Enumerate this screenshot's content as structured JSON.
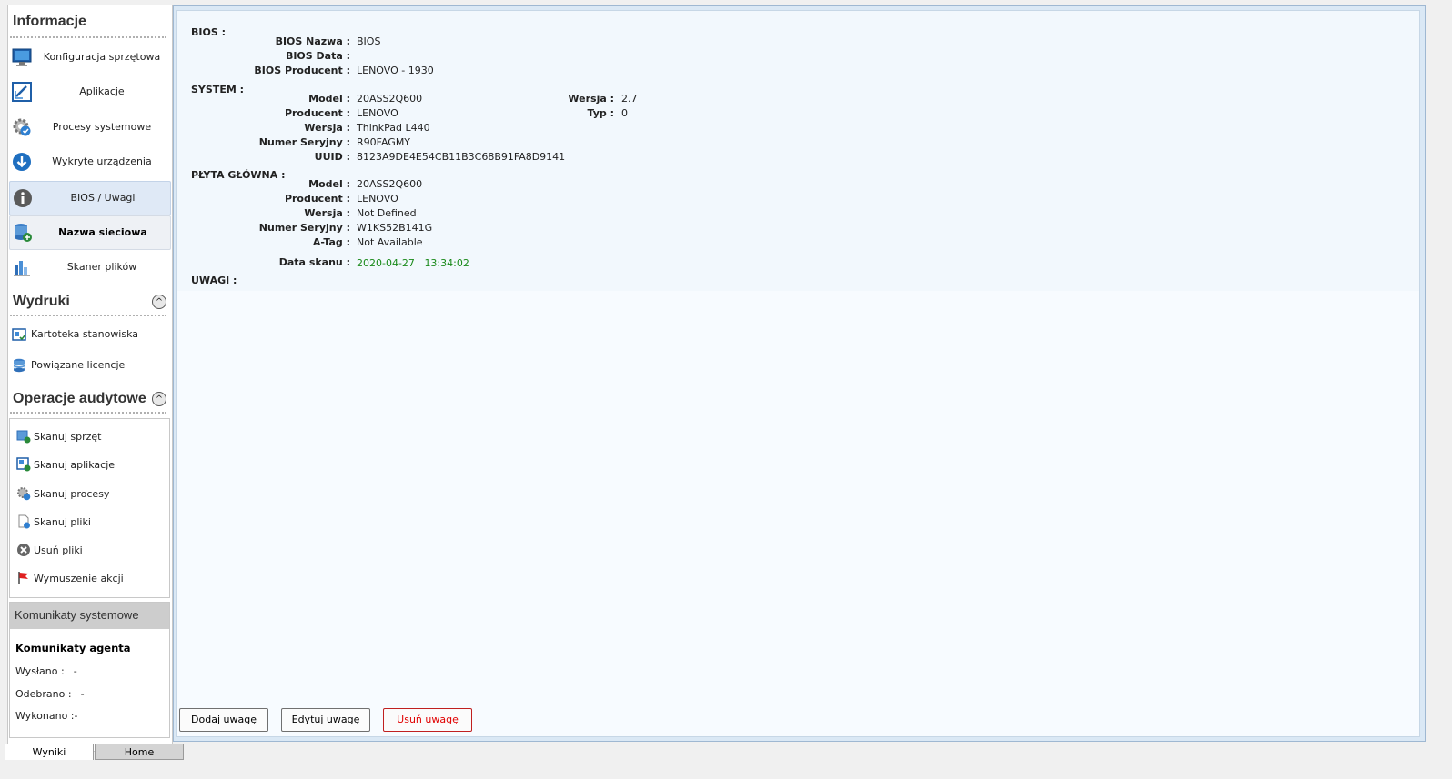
{
  "sidebar": {
    "info_header": "Informacje",
    "nav": [
      {
        "label": "Konfiguracja sprzętowa",
        "icon": "monitor-icon"
      },
      {
        "label": "Aplikacje",
        "icon": "app-window-icon"
      },
      {
        "label": "Procesy systemowe",
        "icon": "gear-process-icon"
      },
      {
        "label": "Wykryte urządzenia",
        "icon": "download-arrow-icon"
      },
      {
        "label": "BIOS / Uwagi",
        "icon": "info-icon"
      },
      {
        "label": "Nazwa sieciowa",
        "icon": "database-network-icon"
      },
      {
        "label": "Skaner plików",
        "icon": "bar-chart-icon"
      }
    ],
    "prints_header": "Wydruki",
    "prints": [
      {
        "label": "Kartoteka stanowiska",
        "icon": "card-icon"
      },
      {
        "label": "Powiązane licencje",
        "icon": "stack-icon"
      }
    ],
    "ops_header": "Operacje audytowe",
    "ops": [
      {
        "label": "Skanuj sprzęt",
        "icon": "scan-hardware-icon"
      },
      {
        "label": "Skanuj aplikacje",
        "icon": "scan-apps-icon"
      },
      {
        "label": "Skanuj procesy",
        "icon": "scan-processes-icon"
      },
      {
        "label": "Skanuj pliki",
        "icon": "scan-files-icon"
      },
      {
        "label": "Usuń pliki",
        "icon": "delete-circle-icon"
      },
      {
        "label": "Wymuszenie akcji",
        "icon": "red-flag-icon"
      }
    ],
    "collapse_glyph": "^",
    "messages": {
      "header": "Komunikaty systemowe",
      "title": "Komunikaty agenta",
      "sent_label": "Wysłano :",
      "sent_value": "-",
      "received_label": "Odebrano :",
      "received_value": "-",
      "done_label": "Wykonano :",
      "done_value": "-"
    }
  },
  "tabs": {
    "results": "Wyniki",
    "home": "Home"
  },
  "bios": {
    "section": "BIOS :",
    "name_label": "BIOS Nazwa :",
    "name_value": "BIOS",
    "date_label": "BIOS Data :",
    "date_value": "",
    "producer_label": "BIOS Producent :",
    "producer_value": "LENOVO - 1930"
  },
  "system": {
    "section": "SYSTEM :",
    "model_label": "Model :",
    "model_value": "20ASS2Q600",
    "producer_label": "Producent :",
    "producer_value": "LENOVO",
    "version_label": "Wersja :",
    "version_value": "ThinkPad L440",
    "serial_label": "Numer Seryjny :",
    "serial_value": "R90FAGMY",
    "uuid_label": "UUID :",
    "uuid_value": "8123A9DE4E54CB11B3C68B91FA8D9141",
    "wersja_label": "Wersja :",
    "wersja_value": "2.7",
    "typ_label": "Typ :",
    "typ_value": "0"
  },
  "board": {
    "section": "PŁYTA GŁÓWNA :",
    "model_label": "Model :",
    "model_value": "20ASS2Q600",
    "producer_label": "Producent :",
    "producer_value": "LENOVO",
    "version_label": "Wersja :",
    "version_value": "Not Defined",
    "serial_label": "Numer Seryjny :",
    "serial_value": "W1KS52B141G",
    "atag_label": "A-Tag :",
    "atag_value": "Not Available"
  },
  "scan": {
    "label": "Data skanu :",
    "date": "2020-04-27",
    "time": "13:34:02"
  },
  "notes": {
    "section": "UWAGI :"
  },
  "buttons": {
    "add": "Dodaj uwagę",
    "edit": "Edytuj uwagę",
    "delete": "Usuń uwagę"
  },
  "colors": {
    "selected_bg": "#dfe9f6",
    "scan_green": "#1a8a1a",
    "danger_red": "#e00000"
  }
}
